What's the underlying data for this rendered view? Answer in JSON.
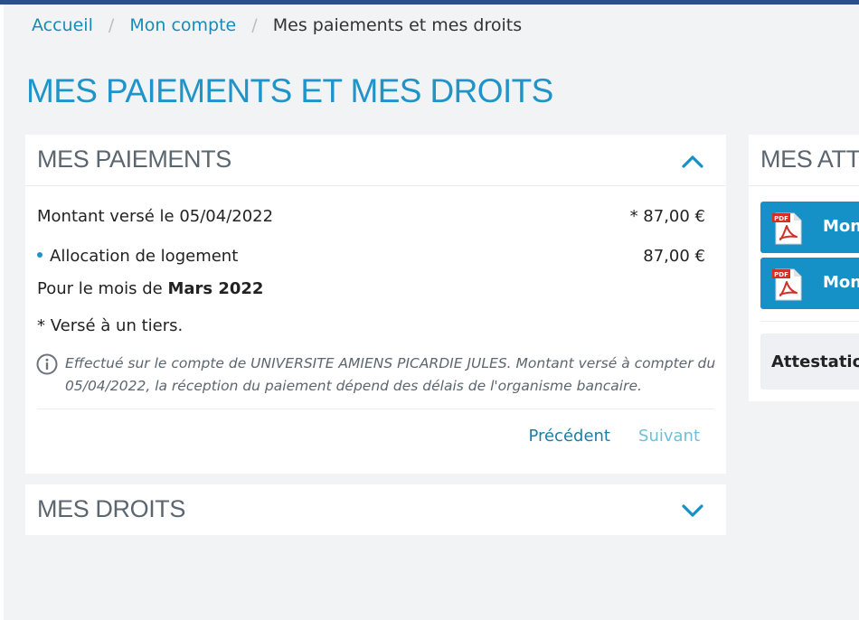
{
  "breadcrumb": {
    "home": "Accueil",
    "account": "Mon compte",
    "current": "Mes paiements et mes droits",
    "separator": "/"
  },
  "page": {
    "title": "MES PAIEMENTS ET MES DROITS"
  },
  "payments": {
    "title": "MES PAIEMENTS",
    "paid_label": "Montant versé le 05/04/2022",
    "paid_amount": "* 87,00 €",
    "allowance_label": "Allocation de logement",
    "allowance_amount": "87,00 €",
    "month_prefix": "Pour le mois de",
    "month_value": "Mars 2022",
    "third_party_note": "* Versé à un tiers.",
    "info_text": "Effectué sur le compte de UNIVERSITE AMIENS PICARDIE JULES. Montant versé à compter du 05/04/2022, la réception du paiement dépend des délais de l'organisme bancaire.",
    "previous_label": "Précédent",
    "next_label": "Suivant"
  },
  "rights": {
    "title": "MES DROITS"
  },
  "attestations": {
    "title": "MES ATTESTATIONS",
    "doc1_label": "Mon",
    "doc2_label": "Mon",
    "box_label": "Attestation",
    "pdf_icon_text": "PDF"
  },
  "colors": {
    "accent": "#1f94c9",
    "link": "#1a8bb5",
    "button": "#1691c7",
    "topbar": "#2c4f8c",
    "background": "#f2f3f5"
  }
}
